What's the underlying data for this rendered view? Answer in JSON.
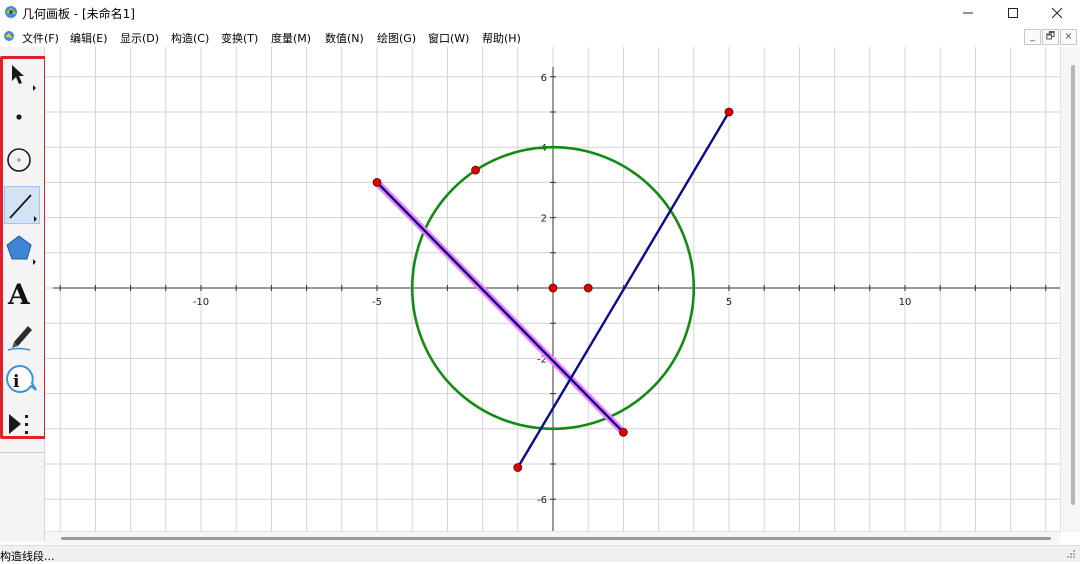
{
  "window": {
    "title": "几何画板 - [未命名1]",
    "buttons": [
      "minimize-icon",
      "maximize-icon",
      "close-icon"
    ]
  },
  "menu": {
    "items": [
      "文件(F)",
      "编辑(E)",
      "显示(D)",
      "构造(C)",
      "变换(T)",
      "度量(M)",
      "数值(N)",
      "绘图(G)",
      "窗口(W)",
      "帮助(H)"
    ],
    "mdi_buttons": [
      "_",
      "🗗",
      "×"
    ]
  },
  "toolbar": {
    "tools": [
      {
        "name": "arrow-tool",
        "icon": "arrow-select-icon",
        "active": false
      },
      {
        "name": "point-tool",
        "icon": "point-icon",
        "active": false
      },
      {
        "name": "compass-tool",
        "icon": "circle-icon",
        "active": false
      },
      {
        "name": "straightedge-tool",
        "icon": "segment-icon",
        "active": true
      },
      {
        "name": "polygon-tool",
        "icon": "polygon-icon",
        "active": false
      },
      {
        "name": "text-tool",
        "icon": "text-icon",
        "active": false
      },
      {
        "name": "marker-tool",
        "icon": "marker-pen-icon",
        "active": false
      },
      {
        "name": "information-tool",
        "icon": "info-icon",
        "active": false
      },
      {
        "name": "custom-tool",
        "icon": "custom-tool-icon",
        "active": false
      }
    ],
    "text_tool_glyph": "A",
    "highlight_color": "#e0202a"
  },
  "graph": {
    "x_ticks": [
      -10,
      -5,
      5,
      10
    ],
    "y_ticks": [
      6,
      4,
      2,
      -2,
      -6
    ],
    "circle": {
      "center": [
        0,
        0
      ],
      "radius": 4,
      "color": "#138a13"
    },
    "segments": [
      {
        "from": [
          -5,
          3
        ],
        "to": [
          2,
          -4.1
        ],
        "color": "#0a0a8c",
        "selected": true
      },
      {
        "from": [
          -1,
          -5.1
        ],
        "to": [
          5,
          5
        ],
        "color": "#0a0a8c",
        "selected": false
      }
    ],
    "points": [
      [
        -5,
        3
      ],
      [
        -2.2,
        3.35
      ],
      [
        0,
        0
      ],
      [
        1,
        0
      ],
      [
        2,
        -4.1
      ],
      [
        -1,
        -5.1
      ],
      [
        5,
        5
      ]
    ],
    "point_color": "#e00000",
    "selection_color": "#ee82ee"
  },
  "status": {
    "text": "构造线段..."
  }
}
